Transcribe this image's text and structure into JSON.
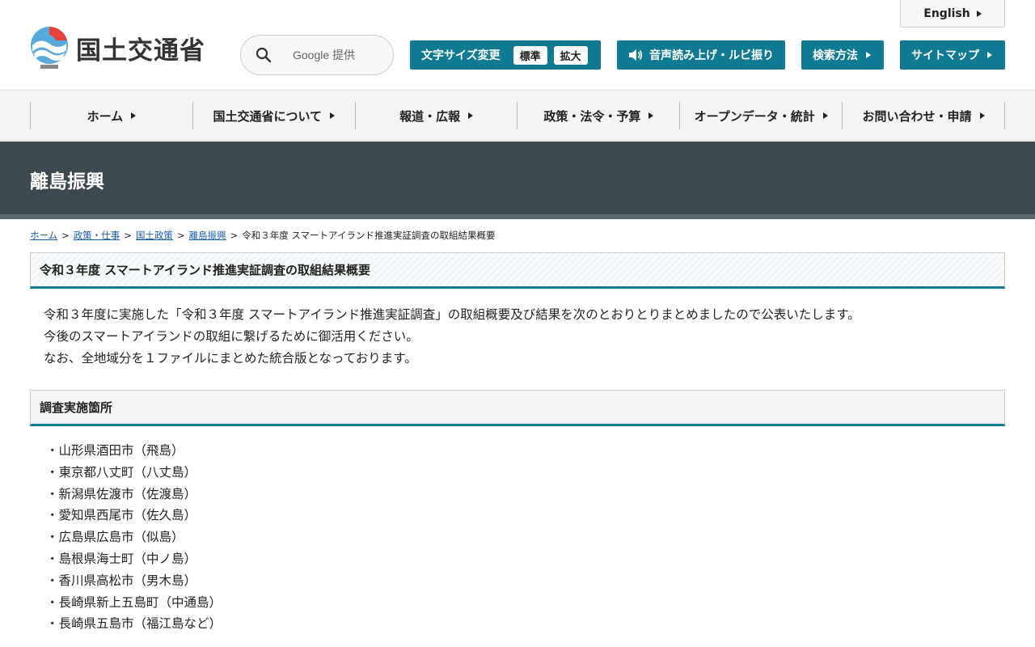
{
  "header": {
    "logo_text": "国土交通省",
    "search": {
      "placeholder": "Google 提供"
    },
    "font_size": {
      "label": "文字サイズ変更",
      "standard": "標準",
      "large": "拡大"
    },
    "speech_button": "音声読み上げ・ルビ振り",
    "search_method_button": "検索方法",
    "sitemap_button": "サイトマップ",
    "english_link": "English"
  },
  "nav": {
    "items": [
      {
        "label": "ホーム"
      },
      {
        "label": "国土交通省について"
      },
      {
        "label": "報道・広報"
      },
      {
        "label": "政策・法令・予算"
      },
      {
        "label": "オープンデータ・統計"
      },
      {
        "label": "お問い合わせ・申請"
      }
    ]
  },
  "page": {
    "title": "離島振興"
  },
  "breadcrumb": {
    "items": [
      "ホーム",
      "政策・仕事",
      "国土政策",
      "離島振興"
    ],
    "current": "令和３年度 スマートアイランド推進実証調査の取組結果概要",
    "separator": ">"
  },
  "main": {
    "heading": "令和３年度 スマートアイランド推進実証調査の取組結果概要",
    "intro": [
      "令和３年度に実施した「令和３年度 スマートアイランド推進実証調査」の取組概要及び結果を次のとおりとりまとめましたので公表いたします。",
      "今後のスマートアイランドの取組に繋げるために御活用ください。",
      "なお、全地域分を１ファイルにまとめた統合版となっております。"
    ],
    "section_heading": "調査実施箇所",
    "locations": [
      "・山形県酒田市（飛島）",
      "・東京都八丈町（八丈島）",
      "・新潟県佐渡市（佐渡島）",
      "・愛知県西尾市（佐久島）",
      "・広島県広島市（似島）",
      "・島根県海士町（中ノ島）",
      "・香川県高松市（男木島）",
      "・長崎県新上五島町（中通島）",
      "・長崎県五島市（福江島など）"
    ]
  },
  "colors": {
    "accent": "#0f7a91",
    "title_band": "#3c4a50",
    "link": "#1a5cb0"
  }
}
